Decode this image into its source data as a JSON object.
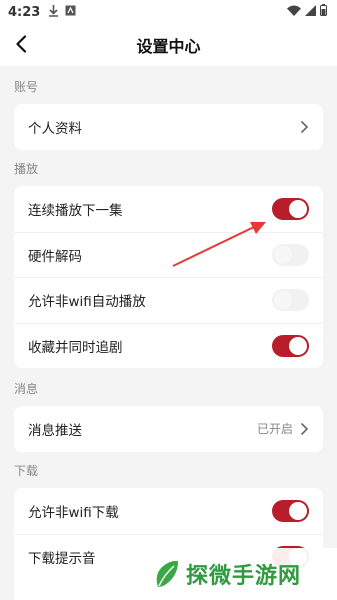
{
  "status_bar": {
    "time": "4:23",
    "icons": [
      "download-icon",
      "app-icon",
      "wifi-icon",
      "signal-icon",
      "battery-icon"
    ]
  },
  "header": {
    "title": "设置中心",
    "back_icon": "chevron-left-icon"
  },
  "sections": [
    {
      "label": "账号",
      "items": [
        {
          "label": "个人资料",
          "type": "link"
        }
      ]
    },
    {
      "label": "播放",
      "items": [
        {
          "label": "连续播放下一集",
          "type": "toggle",
          "on": true
        },
        {
          "label": "硬件解码",
          "type": "toggle",
          "on": false
        },
        {
          "label": "允许非wifi自动播放",
          "type": "toggle",
          "on": false
        },
        {
          "label": "收藏并同时追剧",
          "type": "toggle",
          "on": true
        }
      ]
    },
    {
      "label": "消息",
      "items": [
        {
          "label": "消息推送",
          "type": "link",
          "value": "已开启"
        }
      ]
    },
    {
      "label": "下载",
      "items": [
        {
          "label": "允许非wifi下载",
          "type": "toggle",
          "on": true
        },
        {
          "label": "下载提示音",
          "type": "toggle",
          "on": true
        }
      ]
    }
  ],
  "watermark": {
    "text": "探微手游网"
  },
  "colors": {
    "accent": "#b81d2c",
    "background": "#f4f4f4",
    "card": "#ffffff",
    "annotation_arrow": "#e53935",
    "watermark_green": "#2f9a3e"
  }
}
